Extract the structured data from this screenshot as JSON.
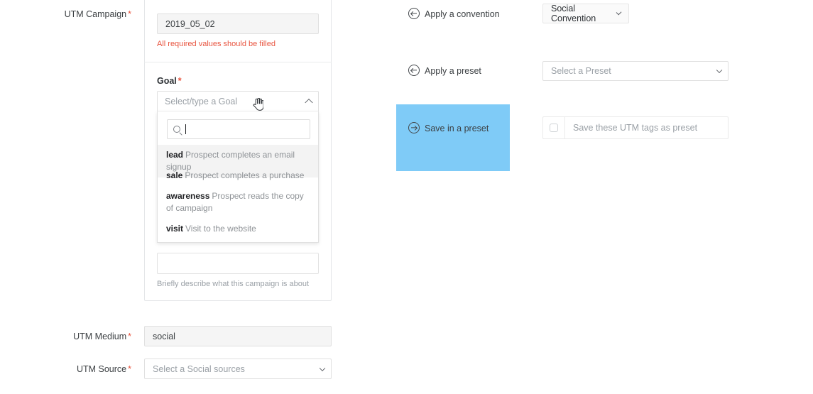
{
  "form": {
    "campaign": {
      "label": "UTM Campaign",
      "required_mark": "*",
      "value": "2019_05_02",
      "error": "All required values should be filled"
    },
    "goal": {
      "label": "Goal",
      "required_mark": "*",
      "placeholder": "Select/type a Goal",
      "search_placeholder": "",
      "options": [
        {
          "key": "lead",
          "description": "Prospect completes an email signup",
          "highlighted": true
        },
        {
          "key": "sale",
          "description": "Prospect completes a purchase",
          "highlighted": false
        },
        {
          "key": "awareness",
          "description": "Prospect reads the copy of campaign",
          "highlighted": false
        },
        {
          "key": "visit",
          "description": "Visit to the website",
          "highlighted": false
        }
      ]
    },
    "description": {
      "value": "",
      "hint": "Briefly describe what this campaign is about"
    },
    "medium": {
      "label": "UTM Medium",
      "required_mark": "*",
      "value": "social"
    },
    "source": {
      "label": "UTM Source",
      "required_mark": "*",
      "placeholder": "Select a Social sources"
    }
  },
  "right_panel": {
    "convention": {
      "label": "Apply a convention",
      "selected": "Social Convention",
      "icon": "circle-arrow-left-icon"
    },
    "preset": {
      "label": "Apply a preset",
      "placeholder": "Select a Preset",
      "icon": "circle-arrow-left-icon"
    },
    "save_preset": {
      "label": "Save in a preset",
      "icon": "circle-arrow-right-icon",
      "checkbox_label": "Save these UTM tags as preset",
      "checked": false
    }
  },
  "colors": {
    "accent_highlight": "#7fcbf7",
    "error": "#e8543f",
    "required": "#e8543f",
    "text": "#3c4043",
    "muted": "#9aa0a6",
    "border": "#e0e0e0"
  }
}
